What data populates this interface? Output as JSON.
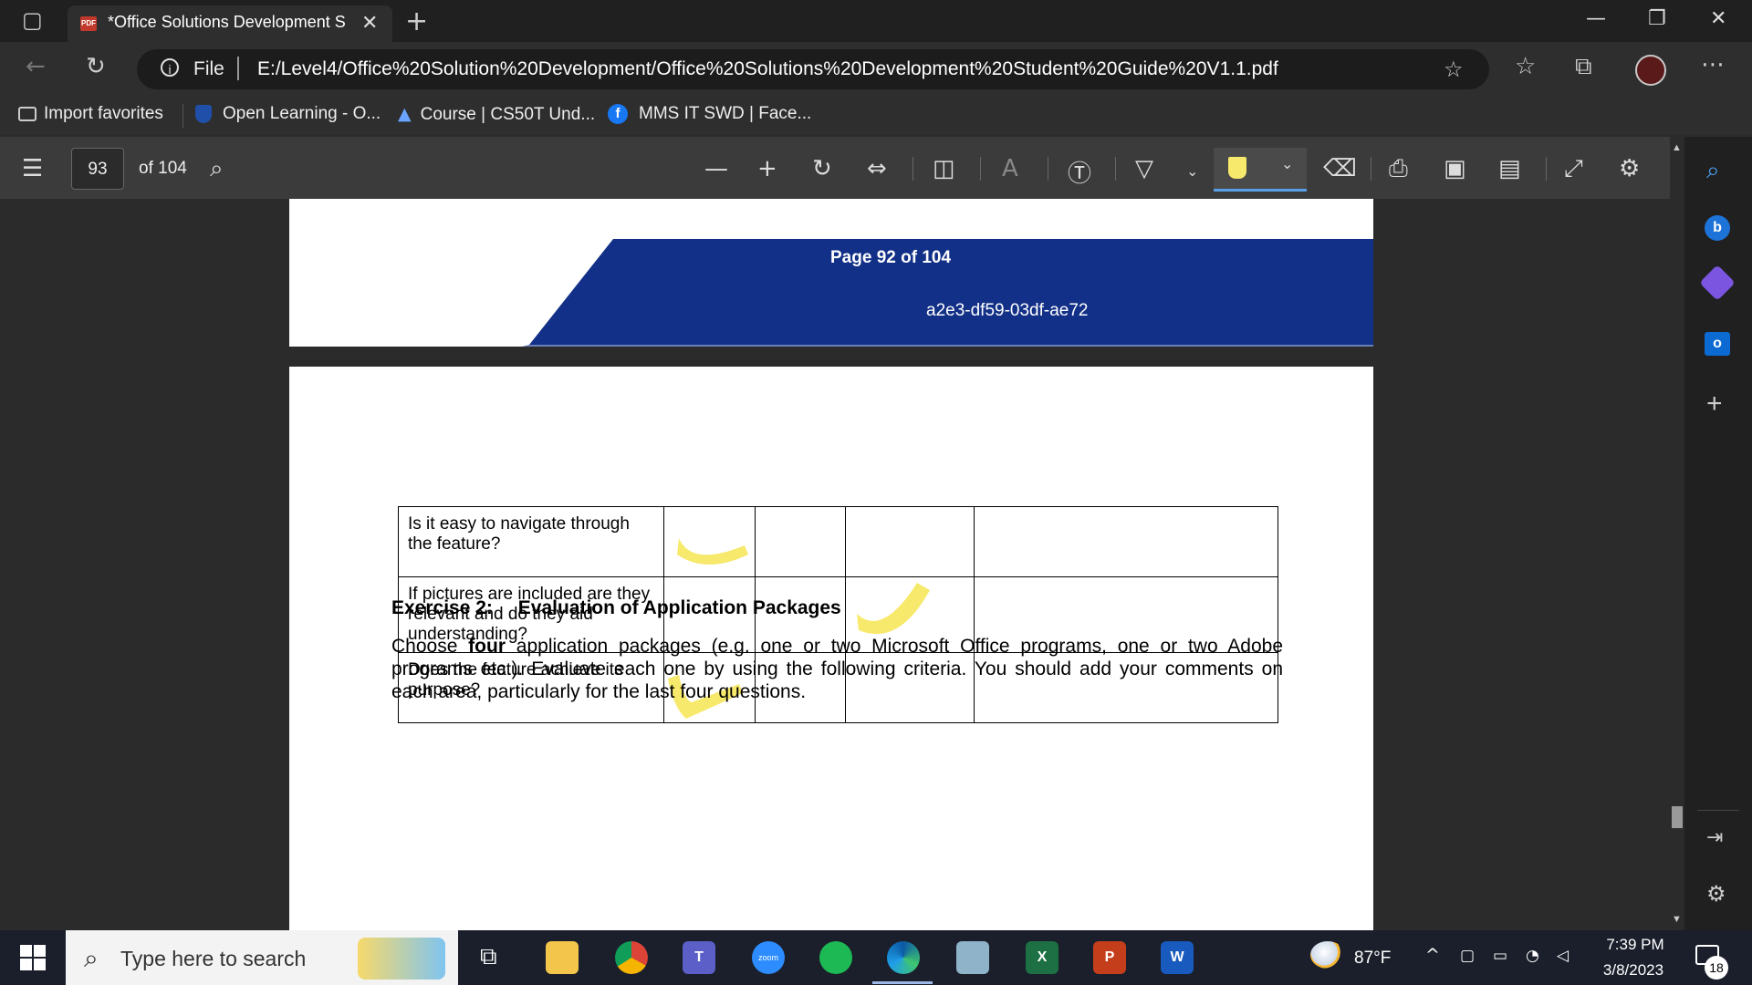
{
  "browser": {
    "tab_title": "*Office Solutions Development S",
    "tab_close": "✕",
    "new_tab": "+",
    "address_prefix": "File",
    "url": "E:/Level4/Office%20Solution%20Development/Office%20Solutions%20Development%20Student%20Guide%20V1.1.pdf"
  },
  "favorites": [
    {
      "label": "Import favorites",
      "icon": "import-icon"
    },
    {
      "label": "Open Learning - O...",
      "icon": "shield-icon"
    },
    {
      "label": "Course | CS50T Und...",
      "icon": "graduation-cap-icon"
    },
    {
      "label": "MMS IT SWD | Face...",
      "icon": "facebook-icon"
    }
  ],
  "pdf_toolbar": {
    "page_number": "93",
    "page_total": "of 104"
  },
  "page_header": {
    "page_label": "Page 92 of 104",
    "doc_code": "a2e3-df59-03df-ae72",
    "band_color": "#123087"
  },
  "table": {
    "rows": [
      {
        "question": "Is it easy to navigate through the feature?",
        "check_column": 1
      },
      {
        "question": "If pictures are included are they relevant and do they aid understanding?",
        "check_column": 3
      },
      {
        "question": "Does the feature achieve its purpose?",
        "check_column": 1
      }
    ],
    "highlight_color": "#f7e96b"
  },
  "exercise": {
    "number": "Exercise 2:",
    "title": "Evaluation of Application Packages",
    "body_before": "Choose ",
    "body_bold": "four",
    "body_after": " application packages (e.g. one or two Microsoft Office programs, one or two Adobe programs etc.). Evaluate each one by using the following criteria. You should add your comments on each area, particularly for the last four questions."
  },
  "taskbar": {
    "search_placeholder": "Type here to search",
    "weather": "87°F",
    "time": "7:39 PM",
    "date": "3/8/2023",
    "notifications": "18"
  }
}
